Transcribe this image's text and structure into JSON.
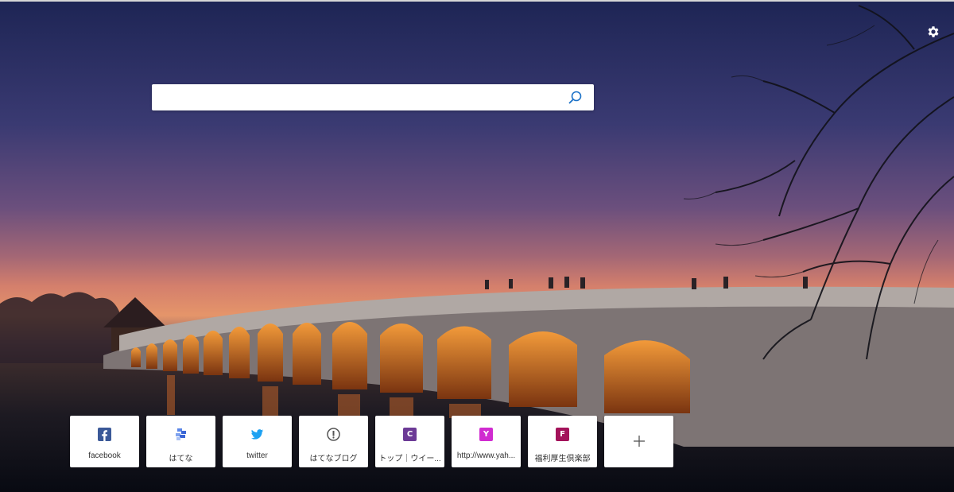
{
  "search": {
    "value": "",
    "placeholder": ""
  },
  "settings": {
    "icon": "gear-icon"
  },
  "top_sites": [
    {
      "label": "facebook",
      "icon": "facebook-icon",
      "color": "#3b5998"
    },
    {
      "label": "はてな",
      "icon": "hatena-icon",
      "color": "#3a66d6"
    },
    {
      "label": "twitter",
      "icon": "twitter-icon",
      "color": "#1da1f2"
    },
    {
      "label": "はてなブログ",
      "icon": "hatena-blog-icon",
      "color": "#555555"
    },
    {
      "label": "トップ｜ウイー...",
      "icon": "c-letter-icon",
      "letter": "C",
      "color": "#6c3a96"
    },
    {
      "label": "http://www.yah...",
      "icon": "y-letter-icon",
      "letter": "Y",
      "color": "#d02bd0"
    },
    {
      "label": "福利厚生倶楽部",
      "icon": "f-letter-icon",
      "letter": "F",
      "color": "#a3125a"
    }
  ],
  "add_tile": {
    "icon": "plus-icon"
  }
}
